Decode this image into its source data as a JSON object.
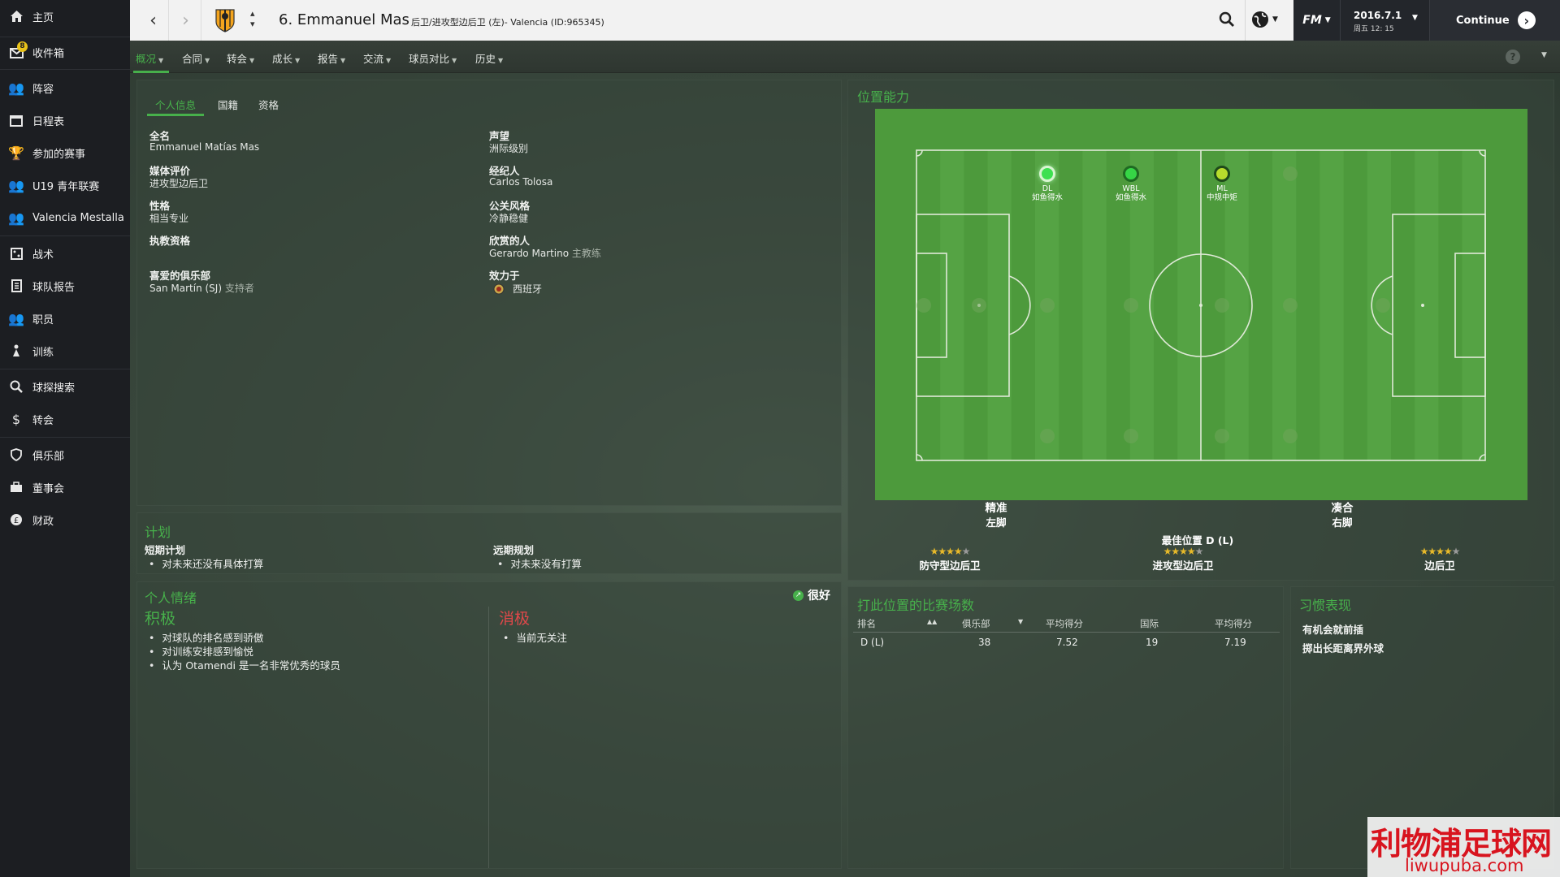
{
  "sidebar": {
    "items": [
      {
        "label": "主页",
        "icon": "home-icon"
      },
      {
        "label": "收件箱",
        "icon": "inbox-icon",
        "badge": "8"
      },
      {
        "label": "阵容",
        "icon": "squad-icon"
      },
      {
        "label": "日程表",
        "icon": "calendar-icon"
      },
      {
        "label": "参加的赛事",
        "icon": "trophy-icon"
      },
      {
        "label": "U19 青年联赛",
        "icon": "youth-icon"
      },
      {
        "label": "Valencia Mestalla",
        "icon": "reserve-team-icon"
      },
      {
        "label": "战术",
        "icon": "tactics-icon"
      },
      {
        "label": "球队报告",
        "icon": "report-icon"
      },
      {
        "label": "职员",
        "icon": "staff-icon"
      },
      {
        "label": "训练",
        "icon": "training-icon"
      },
      {
        "label": "球探搜索",
        "icon": "search-icon"
      },
      {
        "label": "转会",
        "icon": "transfer-icon"
      },
      {
        "label": "俱乐部",
        "icon": "club-icon"
      },
      {
        "label": "董事会",
        "icon": "board-icon"
      },
      {
        "label": "财政",
        "icon": "finance-icon"
      }
    ]
  },
  "topbar": {
    "player_name": "6. Emmanuel Mas",
    "player_sub": "后卫/进攻型边后卫 (左)- Valencia (ID:965345)",
    "date": "2016.7.1",
    "time": "周五 12: 15",
    "continue_label": "Continue",
    "fm_label": "FM"
  },
  "submenu": {
    "items": [
      "概况",
      "合同",
      "转会",
      "成长",
      "报告",
      "交流",
      "球员对比",
      "历史"
    ],
    "active": "概况"
  },
  "profile": {
    "tabs": [
      "个人信息",
      "国籍",
      "资格"
    ],
    "fields_left": [
      {
        "label": "全名",
        "value": "Emmanuel Matías Mas"
      },
      {
        "label": "媒体评价",
        "value": "进攻型边后卫"
      },
      {
        "label": "性格",
        "value": "相当专业"
      },
      {
        "label": "执教资格",
        "value": ""
      },
      {
        "label": "喜爱的俱乐部",
        "value": "San Martín (SJ)",
        "extra": "支持者"
      }
    ],
    "fields_right": [
      {
        "label": "声望",
        "value": "洲际级别"
      },
      {
        "label": "经纪人",
        "value": "Carlos Tolosa"
      },
      {
        "label": "公关风格",
        "value": "冷静稳健"
      },
      {
        "label": "欣赏的人",
        "value": "Gerardo Martino",
        "extra": "主教练"
      },
      {
        "label": "效力于",
        "value": "西班牙"
      }
    ]
  },
  "positions": {
    "title": "位置能力",
    "markers": [
      {
        "code": "DL",
        "desc": "如鱼得水",
        "color": "#39d84a"
      },
      {
        "code": "WBL",
        "desc": "如鱼得水",
        "color": "#39d84a"
      },
      {
        "code": "ML",
        "desc": "中规中矩",
        "color": "#b9dc2e"
      }
    ],
    "left_foot_title": "精准",
    "left_foot": "左脚",
    "right_foot_title": "凑合",
    "right_foot": "右脚",
    "best_position": "最佳位置 D (L)",
    "roles": [
      {
        "name": "防守型边后卫",
        "stars": 4
      },
      {
        "name": "进攻型边后卫",
        "stars": 4
      },
      {
        "name": "边后卫",
        "stars": 4
      }
    ]
  },
  "plans": {
    "title": "计划",
    "short_label": "短期计划",
    "short_items": [
      "对未来还没有具体打算"
    ],
    "long_label": "远期规划",
    "long_items": [
      "对未来没有打算"
    ]
  },
  "mood": {
    "title": "个人情绪",
    "overall": "很好",
    "positive_label": "积极",
    "positive": [
      "对球队的排名感到骄傲",
      "对训练安排感到愉悦",
      "认为 Otamendi 是一名非常优秀的球员"
    ],
    "negative_label": "消极",
    "negative": [
      "当前无关注"
    ]
  },
  "apps": {
    "title": "打此位置的比赛场数",
    "headers": [
      "排名",
      "俱乐部",
      "平均得分",
      "国际",
      "平均得分"
    ],
    "rows": [
      [
        "D (L)",
        "38",
        "7.52",
        "19",
        "7.19"
      ]
    ]
  },
  "habits": {
    "title": "习惯表现",
    "items": [
      "有机会就前插",
      "掷出长距离界外球"
    ]
  },
  "watermark": {
    "line1": "利物浦足球网",
    "line2": "liwupuba.com"
  },
  "colors": {
    "accent": "#47b04b",
    "negative": "#e0484a",
    "sidebar": "#1c1e22",
    "pitch": "#4f9a3e"
  }
}
